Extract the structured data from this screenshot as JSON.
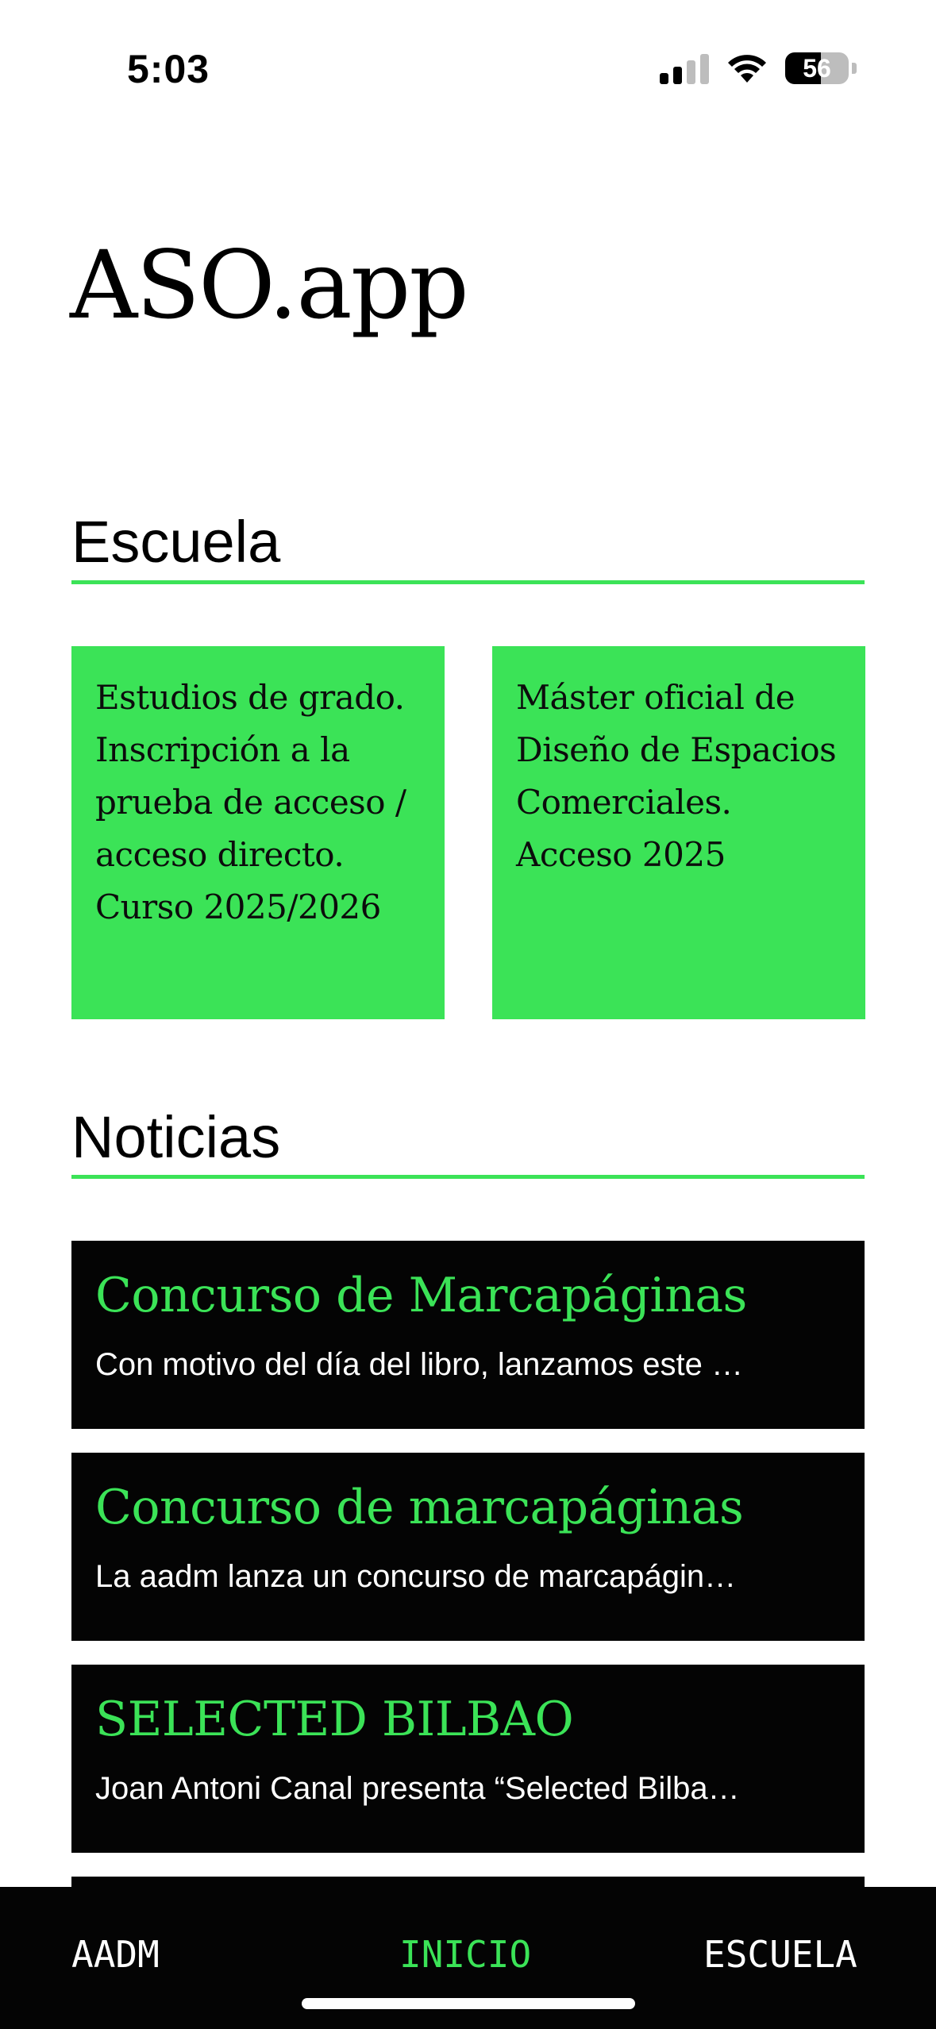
{
  "status_bar": {
    "time": "5:03",
    "battery_level": "56",
    "battery_fraction": 0.56,
    "signal_bars_active": 2,
    "signal_bars_total": 4
  },
  "app": {
    "title": "ASO.app"
  },
  "colors": {
    "accent": "#3be357",
    "dark": "#040404",
    "background": "#ffffff"
  },
  "escuela": {
    "title": "Escuela",
    "cards": [
      {
        "text": "Estudios de grado. Inscripción a la prueba de acceso / acceso directo. Curso 2025/2026"
      },
      {
        "text": "Máster oficial de Diseño de Espacios Comerciales. Acceso 2025"
      }
    ]
  },
  "noticias": {
    "title": "Noticias",
    "items": [
      {
        "title": "Concurso de Marcapáginas",
        "excerpt": "Con motivo del día del libro, lanzamos este …"
      },
      {
        "title": "Concurso de marcapáginas",
        "excerpt": "La aadm lanza un concurso de marcapágin…"
      },
      {
        "title": "SELECTED BILBAO",
        "excerpt": "Joan Antoni Canal presenta “Selected Bilba…"
      }
    ]
  },
  "nav": {
    "items": [
      {
        "label": "AADM"
      },
      {
        "label": "INICIO"
      },
      {
        "label": "ESCUELA"
      }
    ],
    "active": "INICIO"
  },
  "icons": {
    "signal": "cellular-signal-icon",
    "wifi": "wifi-icon",
    "battery": "battery-icon"
  }
}
